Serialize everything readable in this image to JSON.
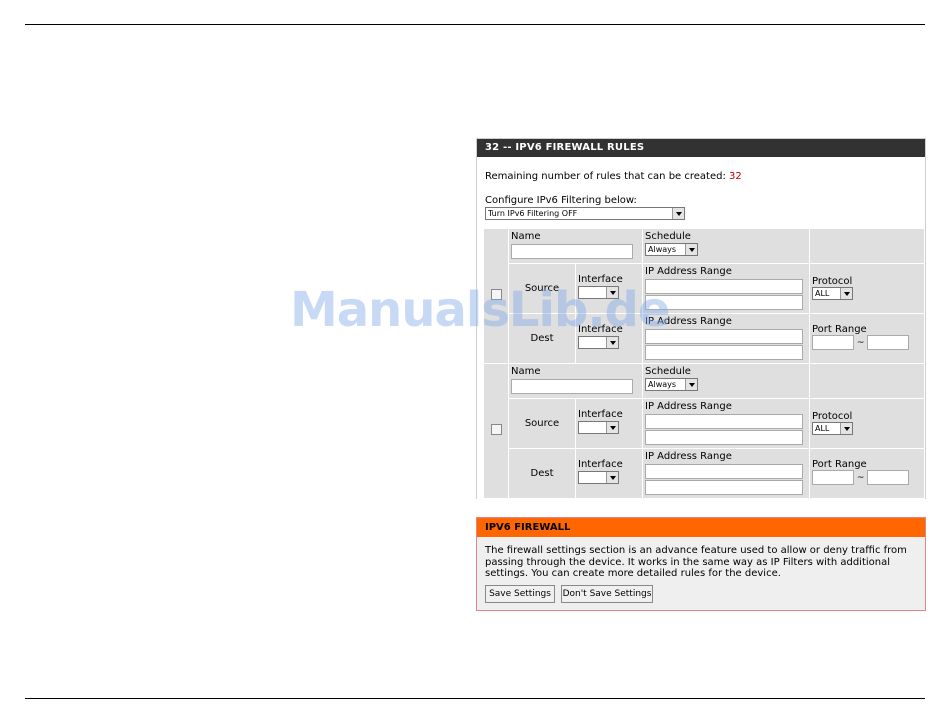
{
  "firewall_rules": {
    "header": "32 -- IPV6 FIREWALL RULES",
    "remaining_label": "Remaining number of rules that can be created:",
    "remaining_count": "32",
    "configure_label": "Configure IPv6 Filtering below:",
    "filter_mode": "Turn IPv6 Filtering OFF",
    "labels": {
      "name": "Name",
      "schedule": "Schedule",
      "source": "Source",
      "dest": "Dest",
      "interface": "Interface",
      "ip_range": "IP Address Range",
      "protocol": "Protocol",
      "port_range": "Port Range",
      "range_dash": "-",
      "tilde": "~"
    },
    "rules": [
      {
        "schedule": "Always",
        "protocol": "ALL"
      },
      {
        "schedule": "Always",
        "protocol": "ALL"
      }
    ]
  },
  "info": {
    "header": "IPV6 FIREWALL",
    "text": "The firewall settings section is an advance feature used to allow or deny traffic from passing through the device. It works in the same way as IP Filters with additional settings. You can create more detailed rules for the device.",
    "save_label": "Save Settings",
    "dont_save_label": "Don't Save Settings"
  },
  "watermark": "ManualsLib.de"
}
